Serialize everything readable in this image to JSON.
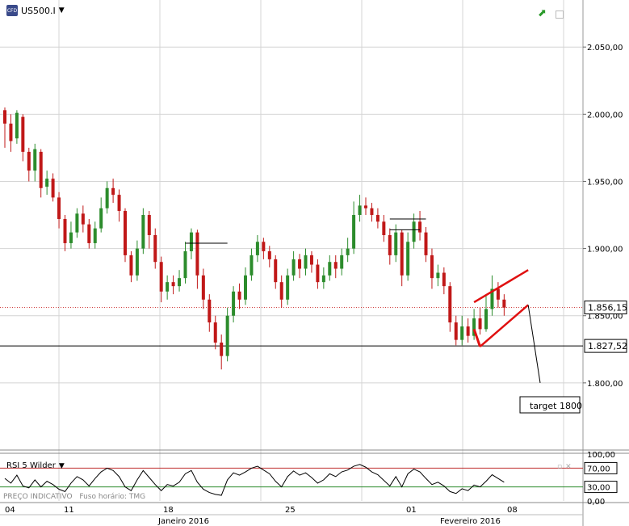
{
  "header": {
    "symbol": "US500.I",
    "dropdown_icon": "caret-down-icon"
  },
  "rsi_panel": {
    "label": "RSI 5 Wilder",
    "footer_left": "PREÇO INDICATIVO",
    "footer_right": "Fuso horário: TMG"
  },
  "colors": {
    "up": "#2c8c2c",
    "down": "#c01818",
    "wedge": "#e01010",
    "rsi_line": "#000000",
    "rsi_70": "#c03030",
    "rsi_30": "#2a8a2a"
  },
  "chart_data": [
    {
      "type": "candlestick",
      "title": "US500.I",
      "ylim": [
        1750,
        2085
      ],
      "y_ticks": [
        "2.050,00",
        "2.000,00",
        "1.950,00",
        "1.900,00",
        "1.850,00",
        "1.800,00"
      ],
      "y_tick_values": [
        2050,
        2000,
        1950,
        1900,
        1850,
        1800
      ],
      "x_day_labels": [
        "04",
        "11",
        "18",
        "25",
        "01",
        "08"
      ],
      "x_month_labels": [
        "Janeiro 2016",
        "Fevereiro 2016"
      ],
      "price_tags": [
        {
          "label": "1.856,15",
          "value": 1856.15,
          "style": "current"
        },
        {
          "label": "1.827,52",
          "value": 1827.52,
          "style": "support"
        }
      ],
      "annotations": [
        {
          "label": "target 1800"
        }
      ],
      "candles": [
        [
          2003,
          1993,
          2005,
          1975
        ],
        [
          1993,
          1980,
          2000,
          1972
        ],
        [
          1982,
          2001,
          2003,
          1978
        ],
        [
          1998,
          1972,
          2000,
          1965
        ],
        [
          1972,
          1958,
          1975,
          1950
        ],
        [
          1958,
          1974,
          1978,
          1950
        ],
        [
          1972,
          1945,
          1974,
          1938
        ],
        [
          1946,
          1952,
          1958,
          1940
        ],
        [
          1952,
          1938,
          1956,
          1935
        ],
        [
          1938,
          1922,
          1942,
          1915
        ],
        [
          1922,
          1904,
          1925,
          1898
        ],
        [
          1904,
          1912,
          1920,
          1900
        ],
        [
          1912,
          1926,
          1930,
          1908
        ],
        [
          1926,
          1918,
          1932,
          1912
        ],
        [
          1918,
          1904,
          1922,
          1900
        ],
        [
          1904,
          1915,
          1920,
          1900
        ],
        [
          1915,
          1930,
          1938,
          1912
        ],
        [
          1930,
          1945,
          1950,
          1926
        ],
        [
          1945,
          1940,
          1952,
          1934
        ],
        [
          1940,
          1928,
          1944,
          1920
        ],
        [
          1928,
          1895,
          1930,
          1890
        ],
        [
          1895,
          1880,
          1898,
          1875
        ],
        [
          1880,
          1900,
          1906,
          1876
        ],
        [
          1900,
          1925,
          1930,
          1896
        ],
        [
          1925,
          1910,
          1928,
          1900
        ],
        [
          1910,
          1890,
          1915,
          1885
        ],
        [
          1890,
          1868,
          1894,
          1860
        ],
        [
          1868,
          1875,
          1880,
          1862
        ],
        [
          1875,
          1872,
          1880,
          1866
        ],
        [
          1872,
          1878,
          1884,
          1868
        ],
        [
          1878,
          1898,
          1905,
          1874
        ],
        [
          1898,
          1912,
          1915,
          1892
        ],
        [
          1912,
          1880,
          1914,
          1870
        ],
        [
          1880,
          1862,
          1885,
          1855
        ],
        [
          1862,
          1845,
          1866,
          1838
        ],
        [
          1845,
          1830,
          1850,
          1825
        ],
        [
          1830,
          1820,
          1836,
          1810
        ],
        [
          1820,
          1850,
          1856,
          1816
        ],
        [
          1850,
          1868,
          1872,
          1845
        ],
        [
          1868,
          1862,
          1874,
          1855
        ],
        [
          1862,
          1880,
          1886,
          1858
        ],
        [
          1880,
          1895,
          1900,
          1876
        ],
        [
          1895,
          1905,
          1910,
          1890
        ],
        [
          1905,
          1898,
          1908,
          1892
        ],
        [
          1898,
          1892,
          1902,
          1886
        ],
        [
          1892,
          1875,
          1895,
          1870
        ],
        [
          1875,
          1862,
          1880,
          1856
        ],
        [
          1862,
          1880,
          1885,
          1858
        ],
        [
          1880,
          1892,
          1898,
          1876
        ],
        [
          1892,
          1885,
          1896,
          1878
        ],
        [
          1885,
          1895,
          1900,
          1880
        ],
        [
          1895,
          1888,
          1898,
          1882
        ],
        [
          1888,
          1875,
          1892,
          1870
        ],
        [
          1875,
          1880,
          1886,
          1870
        ],
        [
          1880,
          1890,
          1895,
          1876
        ],
        [
          1890,
          1885,
          1895,
          1878
        ],
        [
          1885,
          1895,
          1900,
          1880
        ],
        [
          1895,
          1900,
          1908,
          1890
        ],
        [
          1900,
          1925,
          1935,
          1896
        ],
        [
          1925,
          1932,
          1940,
          1920
        ],
        [
          1932,
          1930,
          1938,
          1925
        ],
        [
          1930,
          1925,
          1934,
          1920
        ],
        [
          1925,
          1920,
          1930,
          1915
        ],
        [
          1920,
          1910,
          1925,
          1905
        ],
        [
          1910,
          1895,
          1915,
          1888
        ],
        [
          1895,
          1912,
          1918,
          1890
        ],
        [
          1912,
          1880,
          1914,
          1872
        ],
        [
          1880,
          1905,
          1912,
          1876
        ],
        [
          1905,
          1920,
          1926,
          1900
        ],
        [
          1920,
          1912,
          1928,
          1906
        ],
        [
          1912,
          1895,
          1916,
          1890
        ],
        [
          1895,
          1878,
          1900,
          1870
        ],
        [
          1878,
          1882,
          1888,
          1872
        ],
        [
          1882,
          1872,
          1886,
          1866
        ],
        [
          1872,
          1845,
          1875,
          1838
        ],
        [
          1845,
          1832,
          1850,
          1828
        ],
        [
          1832,
          1842,
          1850,
          1828
        ],
        [
          1842,
          1835,
          1848,
          1830
        ],
        [
          1835,
          1848,
          1855,
          1832
        ],
        [
          1848,
          1840,
          1856,
          1836
        ],
        [
          1840,
          1855,
          1865,
          1838
        ],
        [
          1855,
          1870,
          1880,
          1850
        ],
        [
          1870,
          1862,
          1875,
          1856
        ],
        [
          1862,
          1856,
          1866,
          1850
        ]
      ]
    },
    {
      "type": "line",
      "title": "RSI 5 Wilder",
      "ylim": [
        0,
        100
      ],
      "y_ticks": [
        "100,00",
        "70,00",
        "30,00",
        "0,00"
      ],
      "y_tick_values": [
        100,
        70,
        30,
        0
      ],
      "levels": [
        70,
        30
      ],
      "values": [
        48,
        38,
        55,
        32,
        28,
        45,
        30,
        42,
        35,
        25,
        20,
        38,
        52,
        45,
        32,
        48,
        62,
        70,
        65,
        52,
        30,
        22,
        45,
        65,
        50,
        35,
        22,
        35,
        32,
        40,
        58,
        65,
        40,
        25,
        18,
        14,
        12,
        45,
        60,
        55,
        62,
        70,
        74,
        66,
        58,
        42,
        30,
        52,
        64,
        55,
        60,
        50,
        38,
        45,
        58,
        52,
        62,
        66,
        74,
        78,
        72,
        62,
        56,
        44,
        32,
        52,
        30,
        58,
        68,
        62,
        48,
        35,
        40,
        32,
        20,
        16,
        26,
        22,
        34,
        30,
        42,
        56,
        48,
        40
      ]
    }
  ]
}
